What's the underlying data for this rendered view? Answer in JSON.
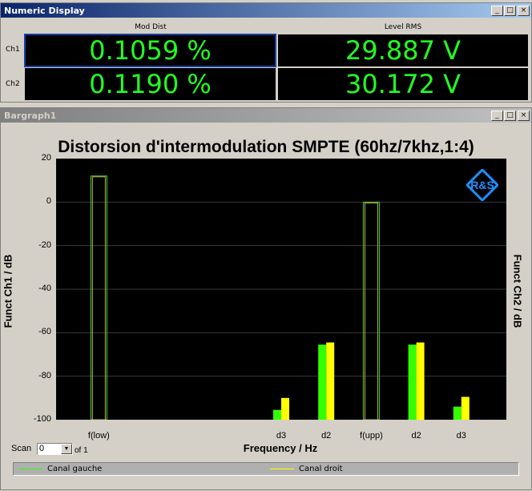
{
  "numeric_display": {
    "title": "Numeric Display",
    "col_mod_dist": "Mod Dist",
    "col_level_rms": "Level RMS",
    "ch1_label": "Ch1",
    "ch2_label": "Ch2",
    "ch1_mod_dist": "0.1059 %",
    "ch1_level_rms": "29.887 V",
    "ch2_mod_dist": "0.1190 %",
    "ch2_level_rms": "30.172 V"
  },
  "window_buttons": {
    "minimize": "_",
    "maximize": "□",
    "close": "×"
  },
  "bargraph": {
    "title": "Bargraph1",
    "scan_label": "Scan",
    "scan_value": "0",
    "scan_of": "of 1",
    "logo": "rohde-schwarz-logo"
  },
  "colors": {
    "ch1": "#33ff00",
    "ch2": "#ffff00",
    "outline": "#4ccc4c",
    "plot_bg": "#000000"
  },
  "chart_data": {
    "type": "bar",
    "title": "Distorsion d'intermodulation SMPTE (60hz/7khz,1:4)",
    "xlabel": "Frequency / Hz",
    "ylabel_left": "Funct Ch1 / dB",
    "ylabel_right": "Funct Ch2 / dB",
    "ylim": [
      -100,
      20
    ],
    "yticks": [
      "20",
      "0",
      "-20",
      "-40",
      "-60",
      "-80",
      "-100"
    ],
    "categories": [
      "f(low)",
      "d3",
      "d2",
      "f(upp)",
      "d2",
      "d3"
    ],
    "series": [
      {
        "name": "Canal gauche",
        "values": [
          12,
          -95.5,
          -65.5,
          0,
          -65.5,
          -94
        ]
      },
      {
        "name": "Canal droit",
        "values": [
          12,
          -90,
          -64.5,
          0,
          -64.5,
          -89.5
        ]
      }
    ],
    "reference_bars": [
      "f(low)",
      "f(upp)"
    ]
  }
}
